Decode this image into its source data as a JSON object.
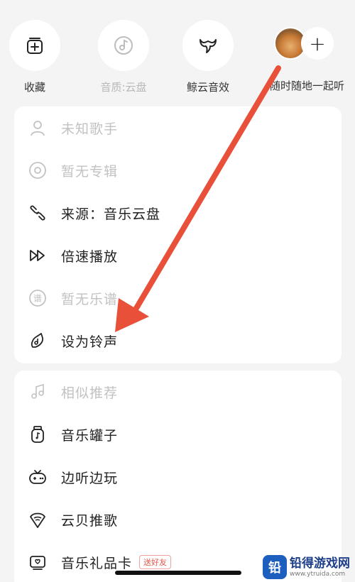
{
  "top": {
    "collect": {
      "label": "收藏",
      "icon": "add-playlist-icon"
    },
    "quality": {
      "label": "音质:云盘",
      "icon": "music-disc-icon"
    },
    "effect": {
      "label": "鲸云音效",
      "icon": "whale-tail-icon"
    },
    "together": {
      "label": "随时随地一起听",
      "icon": "plus-icon",
      "plus": "+"
    }
  },
  "menu1": [
    {
      "label": "未知歌手",
      "icon": "person-icon",
      "disabled": true
    },
    {
      "label": "暂无专辑",
      "icon": "album-icon",
      "disabled": true
    },
    {
      "label": "来源：音乐云盘",
      "icon": "link-icon",
      "disabled": false
    },
    {
      "label": "倍速播放",
      "icon": "fast-forward-icon",
      "disabled": false
    },
    {
      "label": "暂无乐谱",
      "icon": "score-icon",
      "disabled": true
    },
    {
      "label": "设为铃声",
      "icon": "ringtone-icon",
      "disabled": false
    }
  ],
  "menu2": [
    {
      "label": "相似推荐",
      "icon": "similar-music-icon",
      "disabled": true
    },
    {
      "label": "音乐罐子",
      "icon": "music-jar-icon",
      "disabled": false
    },
    {
      "label": "边听边玩",
      "icon": "gamepad-icon",
      "disabled": false
    },
    {
      "label": "云贝推歌",
      "icon": "cloud-coin-icon",
      "disabled": false
    },
    {
      "label": "音乐礼品卡",
      "icon": "gift-card-icon",
      "disabled": false,
      "badge": "送好友"
    }
  ],
  "watermark": {
    "name": "铅得游戏网",
    "url": "www.ytruida.com",
    "logo": "铅"
  },
  "colors": {
    "annotation_arrow": "#e8503a",
    "disabled_text": "#c2c2c2",
    "badge": "#e0554a"
  }
}
